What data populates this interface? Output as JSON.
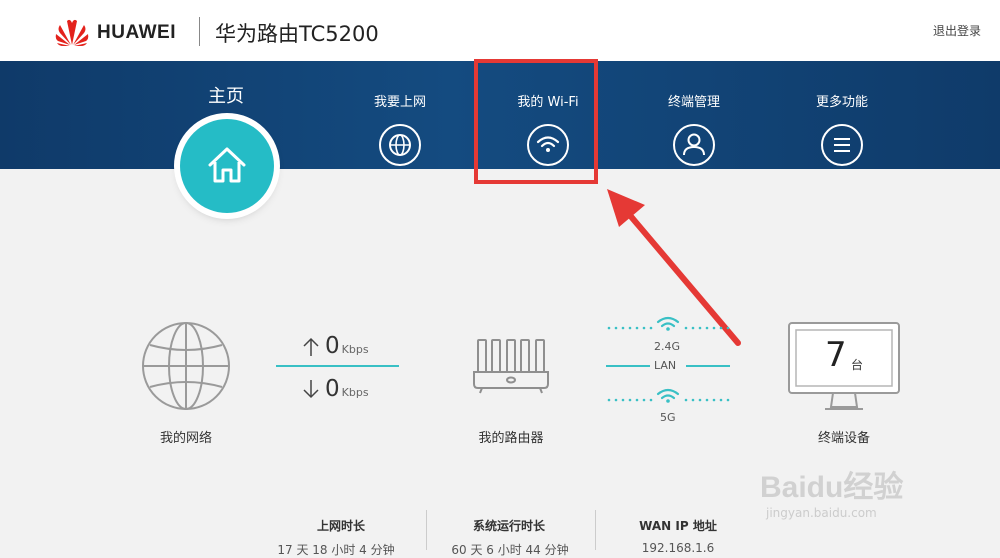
{
  "header": {
    "brand": "HUAWEI",
    "model": "华为路由TC5200",
    "logout": "退出登录"
  },
  "nav": {
    "home": "主页",
    "items": [
      {
        "label": "我要上网",
        "icon": "globe-icon"
      },
      {
        "label": "我的 Wi-Fi",
        "icon": "wifi-icon"
      },
      {
        "label": "终端管理",
        "icon": "user-icon"
      },
      {
        "label": "更多功能",
        "icon": "menu-icon"
      }
    ]
  },
  "status": {
    "network_label": "我的网络",
    "upload_value": "0",
    "download_value": "0",
    "speed_unit": "Kbps",
    "router_label": "我的路由器",
    "band_24": "2.4G",
    "lan": "LAN",
    "band_5": "5G",
    "device_count": "7",
    "device_unit": "台",
    "devices_label": "终端设备"
  },
  "info": [
    {
      "title": "上网时长",
      "value": "17 天 18 小时 4 分钟"
    },
    {
      "title": "系统运行时长",
      "value": "60 天 6 小时 44 分钟"
    },
    {
      "title": "WAN IP 地址",
      "value": "192.168.1.6"
    }
  ],
  "watermark": {
    "text": "Baidu经验",
    "url": "jingyan.baidu.com"
  },
  "colors": {
    "accent": "#25bcc6",
    "nav": "#144b80",
    "highlight": "#e53935",
    "brand": "#e3221c"
  }
}
